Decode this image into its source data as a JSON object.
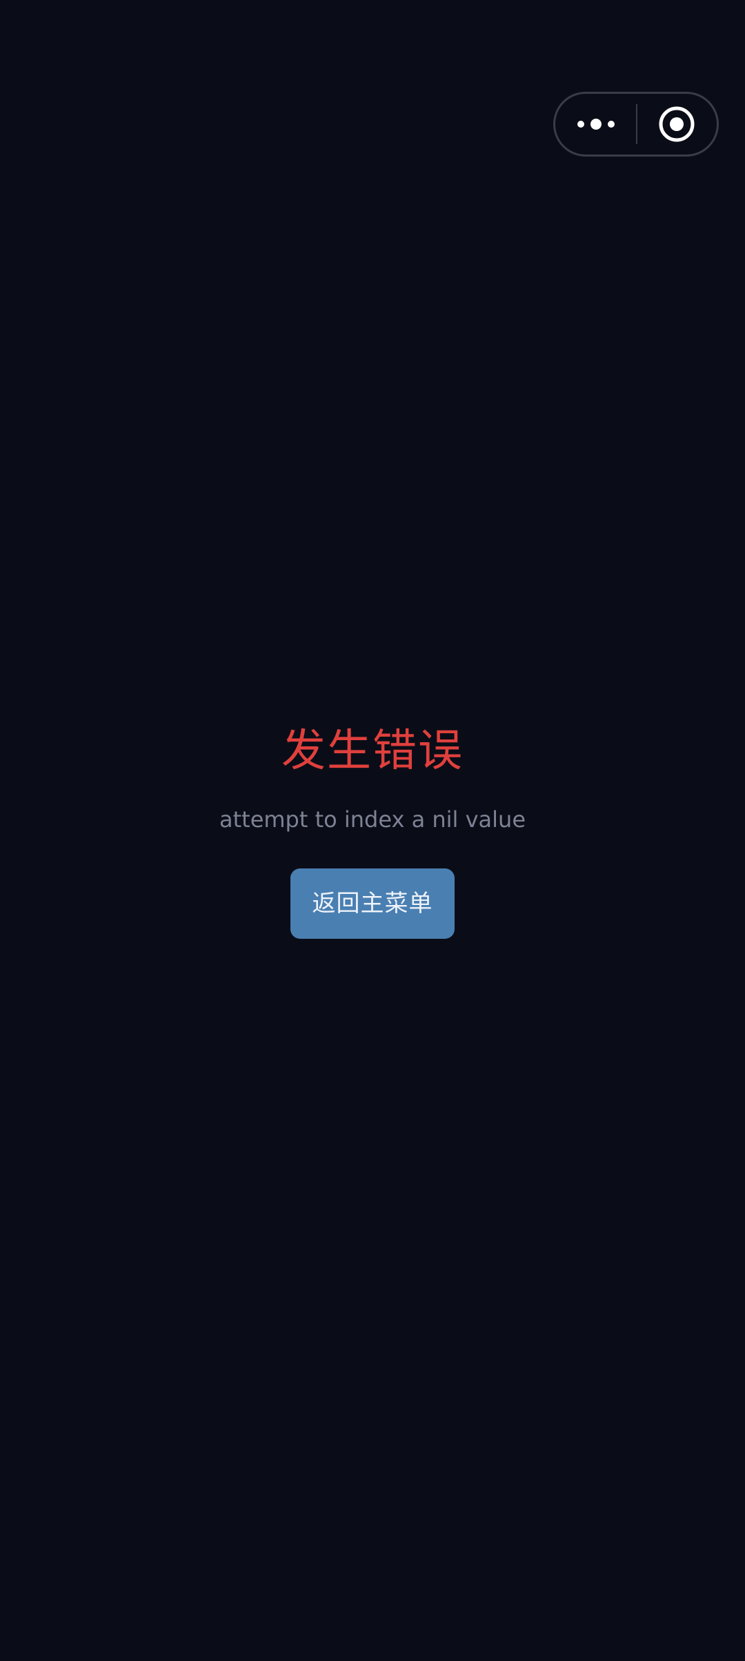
{
  "capsule": {
    "more_icon": "more-dots-icon",
    "close_icon": "target-circle-icon"
  },
  "error": {
    "title": "发生错误",
    "message": "attempt to index a nil value",
    "back_button_label": "返回主菜单"
  },
  "colors": {
    "background": "#0a0d17",
    "title": "#e0403d",
    "message": "#7d8295",
    "button": "#4a7fb2",
    "button_text": "#eef3f9"
  }
}
